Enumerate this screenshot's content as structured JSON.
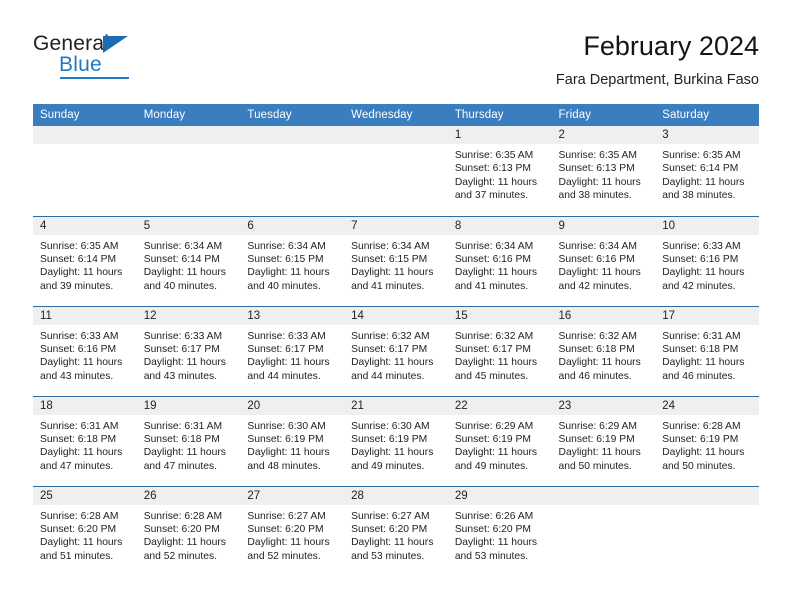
{
  "brand": {
    "name_top": "General",
    "name_bottom": "Blue",
    "accent_color": "#2079c4",
    "triangle_icon": "triangle-icon"
  },
  "header": {
    "title": "February 2024",
    "subtitle": "Fara Department, Burkina Faso"
  },
  "calendar": {
    "header_bg": "#3a7ebf",
    "row_divider_color": "#2e6da4",
    "daynum_band_bg": "#efefef",
    "weekday_headers": [
      "Sunday",
      "Monday",
      "Tuesday",
      "Wednesday",
      "Thursday",
      "Friday",
      "Saturday"
    ],
    "weeks": [
      [
        {
          "day": ""
        },
        {
          "day": ""
        },
        {
          "day": ""
        },
        {
          "day": ""
        },
        {
          "day": "1",
          "sunrise": "Sunrise: 6:35 AM",
          "sunset": "Sunset: 6:13 PM",
          "daylight_1": "Daylight: 11 hours",
          "daylight_2": "and 37 minutes."
        },
        {
          "day": "2",
          "sunrise": "Sunrise: 6:35 AM",
          "sunset": "Sunset: 6:13 PM",
          "daylight_1": "Daylight: 11 hours",
          "daylight_2": "and 38 minutes."
        },
        {
          "day": "3",
          "sunrise": "Sunrise: 6:35 AM",
          "sunset": "Sunset: 6:14 PM",
          "daylight_1": "Daylight: 11 hours",
          "daylight_2": "and 38 minutes."
        }
      ],
      [
        {
          "day": "4",
          "sunrise": "Sunrise: 6:35 AM",
          "sunset": "Sunset: 6:14 PM",
          "daylight_1": "Daylight: 11 hours",
          "daylight_2": "and 39 minutes."
        },
        {
          "day": "5",
          "sunrise": "Sunrise: 6:34 AM",
          "sunset": "Sunset: 6:14 PM",
          "daylight_1": "Daylight: 11 hours",
          "daylight_2": "and 40 minutes."
        },
        {
          "day": "6",
          "sunrise": "Sunrise: 6:34 AM",
          "sunset": "Sunset: 6:15 PM",
          "daylight_1": "Daylight: 11 hours",
          "daylight_2": "and 40 minutes."
        },
        {
          "day": "7",
          "sunrise": "Sunrise: 6:34 AM",
          "sunset": "Sunset: 6:15 PM",
          "daylight_1": "Daylight: 11 hours",
          "daylight_2": "and 41 minutes."
        },
        {
          "day": "8",
          "sunrise": "Sunrise: 6:34 AM",
          "sunset": "Sunset: 6:16 PM",
          "daylight_1": "Daylight: 11 hours",
          "daylight_2": "and 41 minutes."
        },
        {
          "day": "9",
          "sunrise": "Sunrise: 6:34 AM",
          "sunset": "Sunset: 6:16 PM",
          "daylight_1": "Daylight: 11 hours",
          "daylight_2": "and 42 minutes."
        },
        {
          "day": "10",
          "sunrise": "Sunrise: 6:33 AM",
          "sunset": "Sunset: 6:16 PM",
          "daylight_1": "Daylight: 11 hours",
          "daylight_2": "and 42 minutes."
        }
      ],
      [
        {
          "day": "11",
          "sunrise": "Sunrise: 6:33 AM",
          "sunset": "Sunset: 6:16 PM",
          "daylight_1": "Daylight: 11 hours",
          "daylight_2": "and 43 minutes."
        },
        {
          "day": "12",
          "sunrise": "Sunrise: 6:33 AM",
          "sunset": "Sunset: 6:17 PM",
          "daylight_1": "Daylight: 11 hours",
          "daylight_2": "and 43 minutes."
        },
        {
          "day": "13",
          "sunrise": "Sunrise: 6:33 AM",
          "sunset": "Sunset: 6:17 PM",
          "daylight_1": "Daylight: 11 hours",
          "daylight_2": "and 44 minutes."
        },
        {
          "day": "14",
          "sunrise": "Sunrise: 6:32 AM",
          "sunset": "Sunset: 6:17 PM",
          "daylight_1": "Daylight: 11 hours",
          "daylight_2": "and 44 minutes."
        },
        {
          "day": "15",
          "sunrise": "Sunrise: 6:32 AM",
          "sunset": "Sunset: 6:17 PM",
          "daylight_1": "Daylight: 11 hours",
          "daylight_2": "and 45 minutes."
        },
        {
          "day": "16",
          "sunrise": "Sunrise: 6:32 AM",
          "sunset": "Sunset: 6:18 PM",
          "daylight_1": "Daylight: 11 hours",
          "daylight_2": "and 46 minutes."
        },
        {
          "day": "17",
          "sunrise": "Sunrise: 6:31 AM",
          "sunset": "Sunset: 6:18 PM",
          "daylight_1": "Daylight: 11 hours",
          "daylight_2": "and 46 minutes."
        }
      ],
      [
        {
          "day": "18",
          "sunrise": "Sunrise: 6:31 AM",
          "sunset": "Sunset: 6:18 PM",
          "daylight_1": "Daylight: 11 hours",
          "daylight_2": "and 47 minutes."
        },
        {
          "day": "19",
          "sunrise": "Sunrise: 6:31 AM",
          "sunset": "Sunset: 6:18 PM",
          "daylight_1": "Daylight: 11 hours",
          "daylight_2": "and 47 minutes."
        },
        {
          "day": "20",
          "sunrise": "Sunrise: 6:30 AM",
          "sunset": "Sunset: 6:19 PM",
          "daylight_1": "Daylight: 11 hours",
          "daylight_2": "and 48 minutes."
        },
        {
          "day": "21",
          "sunrise": "Sunrise: 6:30 AM",
          "sunset": "Sunset: 6:19 PM",
          "daylight_1": "Daylight: 11 hours",
          "daylight_2": "and 49 minutes."
        },
        {
          "day": "22",
          "sunrise": "Sunrise: 6:29 AM",
          "sunset": "Sunset: 6:19 PM",
          "daylight_1": "Daylight: 11 hours",
          "daylight_2": "and 49 minutes."
        },
        {
          "day": "23",
          "sunrise": "Sunrise: 6:29 AM",
          "sunset": "Sunset: 6:19 PM",
          "daylight_1": "Daylight: 11 hours",
          "daylight_2": "and 50 minutes."
        },
        {
          "day": "24",
          "sunrise": "Sunrise: 6:28 AM",
          "sunset": "Sunset: 6:19 PM",
          "daylight_1": "Daylight: 11 hours",
          "daylight_2": "and 50 minutes."
        }
      ],
      [
        {
          "day": "25",
          "sunrise": "Sunrise: 6:28 AM",
          "sunset": "Sunset: 6:20 PM",
          "daylight_1": "Daylight: 11 hours",
          "daylight_2": "and 51 minutes."
        },
        {
          "day": "26",
          "sunrise": "Sunrise: 6:28 AM",
          "sunset": "Sunset: 6:20 PM",
          "daylight_1": "Daylight: 11 hours",
          "daylight_2": "and 52 minutes."
        },
        {
          "day": "27",
          "sunrise": "Sunrise: 6:27 AM",
          "sunset": "Sunset: 6:20 PM",
          "daylight_1": "Daylight: 11 hours",
          "daylight_2": "and 52 minutes."
        },
        {
          "day": "28",
          "sunrise": "Sunrise: 6:27 AM",
          "sunset": "Sunset: 6:20 PM",
          "daylight_1": "Daylight: 11 hours",
          "daylight_2": "and 53 minutes."
        },
        {
          "day": "29",
          "sunrise": "Sunrise: 6:26 AM",
          "sunset": "Sunset: 6:20 PM",
          "daylight_1": "Daylight: 11 hours",
          "daylight_2": "and 53 minutes."
        },
        {
          "day": ""
        },
        {
          "day": ""
        }
      ]
    ]
  }
}
